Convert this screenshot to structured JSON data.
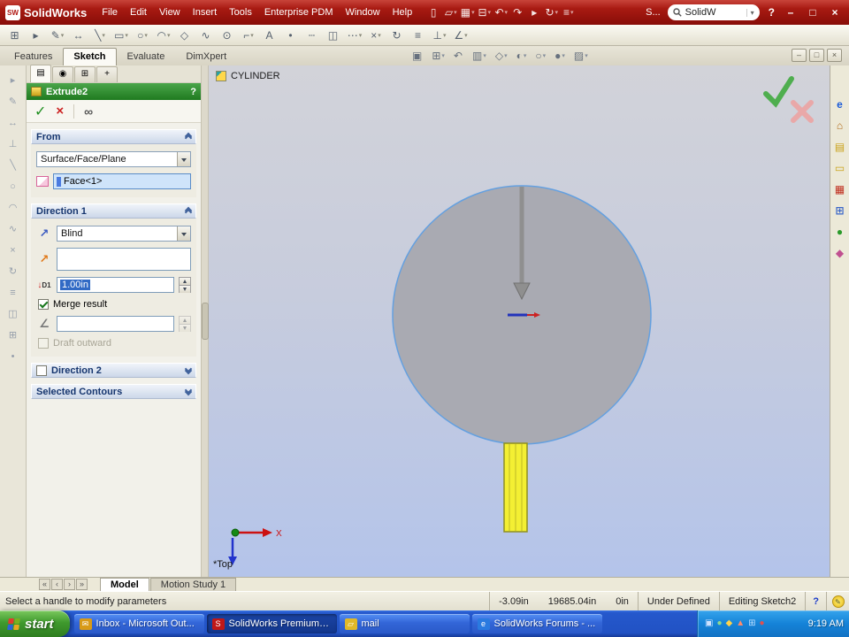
{
  "titlebar": {
    "logo_text": "SolidWorks",
    "menus": [
      {
        "name": "menu-file",
        "label": "File"
      },
      {
        "name": "menu-edit",
        "label": "Edit"
      },
      {
        "name": "menu-view",
        "label": "View"
      },
      {
        "name": "menu-insert",
        "label": "Insert"
      },
      {
        "name": "menu-tools",
        "label": "Tools"
      },
      {
        "name": "menu-enterprise-pdm",
        "label": "Enterprise PDM"
      },
      {
        "name": "menu-window",
        "label": "Window"
      },
      {
        "name": "menu-help",
        "label": "Help"
      }
    ],
    "quick_icons": [
      {
        "name": "new-document-icon",
        "glyph": "▯"
      },
      {
        "name": "open-icon",
        "glyph": "▱",
        "caret": "▾"
      },
      {
        "name": "save-icon",
        "glyph": "▦",
        "caret": "▾"
      },
      {
        "name": "print-icon",
        "glyph": "⊟",
        "caret": "▾"
      },
      {
        "name": "undo-icon",
        "glyph": "↶",
        "caret": "▾"
      },
      {
        "name": "redo-icon",
        "glyph": "↷"
      },
      {
        "name": "select-icon",
        "glyph": "▸"
      },
      {
        "name": "rebuild-icon",
        "glyph": "↻",
        "caret": "▾"
      },
      {
        "name": "options-icon",
        "glyph": "≡",
        "caret": "▾"
      }
    ],
    "overflow_label": "S...",
    "search_value": "SolidW",
    "help_label": "?",
    "window_buttons": [
      {
        "name": "minimize-button",
        "glyph": "–"
      },
      {
        "name": "restore-button",
        "glyph": "□"
      },
      {
        "name": "close-button",
        "glyph": "×"
      }
    ]
  },
  "toolbar2": {
    "icons": [
      {
        "name": "grid-icon",
        "glyph": "⊞"
      },
      {
        "name": "select-arrow-icon",
        "glyph": "▸"
      },
      {
        "name": "sketch-icon",
        "glyph": "✎",
        "caret": "▾"
      },
      {
        "name": "smart-dimension-icon",
        "glyph": "↔"
      },
      {
        "name": "line-icon",
        "glyph": "╲",
        "caret": "▾"
      },
      {
        "name": "rectangle-icon",
        "glyph": "▭",
        "caret": "▾"
      },
      {
        "name": "circle-icon",
        "glyph": "○",
        "caret": "▾"
      },
      {
        "name": "arc-icon",
        "glyph": "◠",
        "caret": "▾"
      },
      {
        "name": "polygon-icon",
        "glyph": "◇"
      },
      {
        "name": "spline-icon",
        "glyph": "∿"
      },
      {
        "name": "ellipse-icon",
        "glyph": "⊙"
      },
      {
        "name": "fillet-icon",
        "glyph": "⌐",
        "caret": "▾"
      },
      {
        "name": "text-icon",
        "glyph": "A"
      },
      {
        "name": "point-icon",
        "glyph": "•"
      },
      {
        "name": "centerline-icon",
        "glyph": "┄"
      },
      {
        "name": "mirror-entities-icon",
        "glyph": "◫"
      },
      {
        "name": "linear-pattern-icon",
        "glyph": "⋯",
        "caret": "▾"
      },
      {
        "name": "trim-entities-icon",
        "glyph": "×",
        "caret": "▾"
      },
      {
        "name": "convert-entities-icon",
        "glyph": "↻"
      },
      {
        "name": "offset-entities-icon",
        "glyph": "≡"
      },
      {
        "name": "display-relations-icon",
        "glyph": "⊥",
        "caret": "▾"
      },
      {
        "name": "quick-snaps-icon",
        "glyph": "∠",
        "caret": "▾"
      }
    ]
  },
  "ribbon": {
    "tabs": [
      {
        "name": "tab-features",
        "label": "Features"
      },
      {
        "name": "tab-sketch",
        "label": "Sketch",
        "active": true
      },
      {
        "name": "tab-evaluate",
        "label": "Evaluate"
      },
      {
        "name": "tab-dimxpert",
        "label": "DimXpert"
      }
    ]
  },
  "headsup": {
    "icons": [
      {
        "name": "zoom-fit-icon",
        "glyph": "▣"
      },
      {
        "name": "zoom-area-icon",
        "glyph": "⊞",
        "caret": "▾"
      },
      {
        "name": "previous-view-icon",
        "glyph": "↶"
      },
      {
        "name": "section-view-icon",
        "glyph": "▥",
        "caret": "▾"
      },
      {
        "name": "view-orientation-icon",
        "glyph": "◇",
        "caret": "▾"
      },
      {
        "name": "display-style-icon",
        "glyph": "◐",
        "caret": "▾"
      },
      {
        "name": "hide-show-icon",
        "glyph": "○",
        "caret": "▾"
      },
      {
        "name": "edit-appearance-icon",
        "glyph": "●",
        "caret": "▾"
      },
      {
        "name": "scene-icon",
        "glyph": "▨",
        "caret": "▾"
      }
    ]
  },
  "doc_window_buttons": [
    {
      "name": "doc-minimize-button",
      "glyph": "–"
    },
    {
      "name": "doc-restore-button",
      "glyph": "□"
    },
    {
      "name": "doc-close-button",
      "glyph": "×"
    }
  ],
  "left_toolbar": {
    "icons": [
      {
        "name": "select-tool-icon",
        "glyph": "▸"
      },
      {
        "name": "sketch-entity-icon",
        "glyph": "✎"
      },
      {
        "name": "dimension-tool-icon",
        "glyph": "↔"
      },
      {
        "name": "relation-tool-icon",
        "glyph": "⊥"
      },
      {
        "name": "line-tool-icon",
        "glyph": "╲"
      },
      {
        "name": "circle-tool-icon",
        "glyph": "○"
      },
      {
        "name": "arc-tool-icon",
        "glyph": "◠"
      },
      {
        "name": "spline-tool-icon",
        "glyph": "∿"
      },
      {
        "name": "trim-tool-icon",
        "glyph": "×"
      },
      {
        "name": "convert-tool-icon",
        "glyph": "↻"
      },
      {
        "name": "offset-tool-icon",
        "glyph": "≡"
      },
      {
        "name": "mirror-tool-icon",
        "glyph": "◫"
      },
      {
        "name": "pattern-tool-icon",
        "glyph": "⊞"
      },
      {
        "name": "point-tool-icon",
        "glyph": "•"
      }
    ]
  },
  "property_manager": {
    "tabs": [
      {
        "name": "pm-tab-properties",
        "glyph": "▤",
        "active": true
      },
      {
        "name": "pm-tab-configurations",
        "glyph": "◉"
      },
      {
        "name": "pm-tab-dimxpert",
        "glyph": "⊞"
      },
      {
        "name": "pm-tab-display",
        "glyph": "+"
      }
    ],
    "title": "Extrude2",
    "help_label": "?",
    "from": {
      "header": "From",
      "dropdown_value": "Surface/Face/Plane",
      "face_value": "Face<1>"
    },
    "direction1": {
      "header": "Direction 1",
      "dropdown_value": "Blind",
      "depth_label": "D1",
      "depth_value": "1.00in",
      "merge_label": "Merge result",
      "draft_outward_label": "Draft outward"
    },
    "direction2": {
      "header": "Direction 2"
    },
    "contours": {
      "header": "Selected Contours"
    }
  },
  "icons": {
    "pm_ok": "✓",
    "pm_cancel": "×",
    "pm_preview": "∞",
    "dir1_axis": "↗",
    "dir1_reference": "↗",
    "depth_arrow": "↓",
    "draft": "∠",
    "pencil": "✎"
  },
  "viewport": {
    "doc_label": "CYLINDER",
    "view_label": "*Top",
    "axis_x_label": "X"
  },
  "taskpane": {
    "icons": [
      {
        "name": "solidworks-resources-icon",
        "glyph": "e",
        "color": "#1a5ad8"
      },
      {
        "name": "design-library-icon",
        "glyph": "⌂",
        "color": "#b06a1a"
      },
      {
        "name": "file-explorer-icon",
        "glyph": "▤",
        "color": "#caa21a"
      },
      {
        "name": "search-results-icon",
        "glyph": "▭",
        "color": "#caa21a"
      },
      {
        "name": "toolbox-icon",
        "glyph": "▦",
        "color": "#c03020"
      },
      {
        "name": "document-recovery-icon",
        "glyph": "⊞",
        "color": "#3a66c8"
      },
      {
        "name": "pdm-vault-icon",
        "glyph": "●",
        "color": "#2a9a2a"
      },
      {
        "name": "appearances-icon",
        "glyph": "◆",
        "color": "#c05090"
      }
    ]
  },
  "bottom_tabs": {
    "scroll_buttons": [
      {
        "name": "tab-scroll-first",
        "glyph": "«"
      },
      {
        "name": "tab-scroll-prev",
        "glyph": "‹"
      },
      {
        "name": "tab-scroll-next",
        "glyph": "›"
      },
      {
        "name": "tab-scroll-last",
        "glyph": "»"
      }
    ],
    "tabs": [
      {
        "name": "tab-model",
        "label": "Model",
        "active": true
      },
      {
        "name": "tab-motion-study",
        "label": "Motion Study 1"
      }
    ]
  },
  "status_bar": {
    "message": "Select a handle to modify parameters",
    "coord_x": "-3.09in",
    "coord_y": "19685.04in",
    "coord_z": "0in",
    "state": "Under Defined",
    "mode": "Editing Sketch2",
    "help": "?"
  },
  "taskbar": {
    "start_label": "start",
    "buttons": [
      {
        "name": "task-outlook",
        "label": "Inbox - Microsoft Out...",
        "icon_glyph": "✉",
        "icon_bg": "#d89a18"
      },
      {
        "name": "task-solidworks",
        "label": "SolidWorks Premium 2...",
        "icon_glyph": "S",
        "icon_bg": "#c01818",
        "active": true
      },
      {
        "name": "task-mail-folder",
        "label": "mail",
        "icon_glyph": "▱",
        "icon_bg": "#e0b828"
      },
      {
        "name": "task-ie-forums",
        "label": "SolidWorks Forums - ...",
        "icon_glyph": "e",
        "icon_bg": "#2a7ae0"
      }
    ],
    "tray_icons": [
      {
        "name": "tray-icon-display",
        "glyph": "▣",
        "color": "#cfe2ff"
      },
      {
        "name": "tray-icon-antivirus",
        "glyph": "●",
        "color": "#8fd88f"
      },
      {
        "name": "tray-icon-updates",
        "glyph": "◆",
        "color": "#ffd24a"
      },
      {
        "name": "tray-icon-alert",
        "glyph": "▲",
        "color": "#ff8a6a"
      },
      {
        "name": "tray-icon-network",
        "glyph": "⊞",
        "color": "#bfe0ff"
      },
      {
        "name": "tray-icon-volume",
        "glyph": "●",
        "color": "#e05050"
      }
    ],
    "clock": "9:19 AM"
  },
  "colors": {
    "titlebar_red": "#a81a12",
    "pm_title_green": "#2e8b2e",
    "selection_highlight": "#316ac5",
    "face_field_blue": "#cfe4fa",
    "viewport_top": "#d2d3d9",
    "viewport_bottom": "#b4c4ea",
    "model_gray": "#a9aab2",
    "edge_blue": "#64a0e0",
    "preview_yellow": "#f3ef33",
    "taskbar_blue": "#2152c4",
    "start_green": "#3f9a2e"
  }
}
